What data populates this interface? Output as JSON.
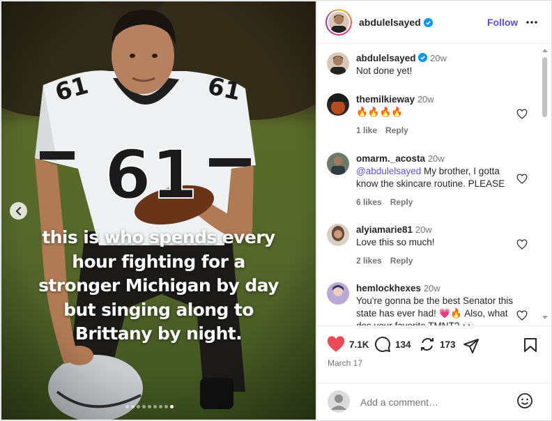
{
  "post": {
    "caption_lines": [
      "this is who spends every",
      "hour fighting for a",
      "stronger Michigan by day",
      "but singing along to",
      "Brittany by night."
    ],
    "jersey_number": "61",
    "carousel": {
      "count": 9,
      "active": 9
    }
  },
  "header": {
    "username": "abdulelsayed",
    "follow_label": "Follow"
  },
  "comments": [
    {
      "username": "abdulelsayed",
      "time": "20w",
      "text": "Not done yet!",
      "verified": true
    },
    {
      "username": "themilkieway",
      "time": "20w",
      "text": "🔥🔥🔥🔥",
      "likes": "1 like",
      "reply": "Reply"
    },
    {
      "username": "omarm._acosta",
      "time": "20w",
      "mention": "@abdulelsayed",
      "text": " My brother, I gotta know the skincare routine. PLEASE",
      "likes": "6 likes",
      "reply": "Reply"
    },
    {
      "username": "alyiamarie81",
      "time": "20w",
      "text": "Love this so much!",
      "likes": "2 likes",
      "reply": "Reply"
    },
    {
      "username": "hemlockhexes",
      "time": "20w",
      "text": "You're gonna be the best Senator this state has ever had! 💗🔥 Also, what dos your favorite TMNT? 👀"
    }
  ],
  "actions": {
    "likes": "7.1K",
    "comments": "134",
    "reposts": "173",
    "date": "March 17"
  },
  "add_comment": {
    "placeholder": "Add a comment…"
  },
  "colors": {
    "link": "#5b51d8",
    "like_red": "#ed4956",
    "verified_blue": "#0095f6"
  }
}
